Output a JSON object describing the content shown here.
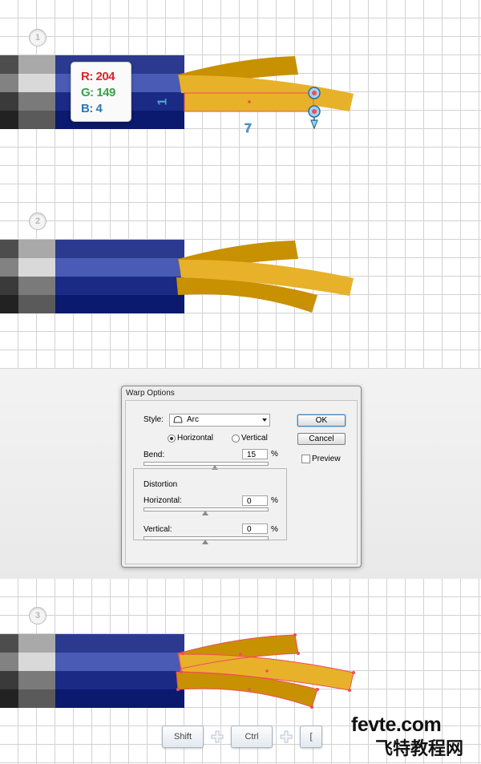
{
  "steps": [
    {
      "number": "1"
    },
    {
      "number": "2"
    },
    {
      "number": "3"
    }
  ],
  "swatch": {
    "r": "R: 204",
    "g": "G: 149",
    "b": "B: 4",
    "r_color": "#d9262b",
    "g_color": "#38a14a",
    "b_color": "#2d77b6"
  },
  "dimensions": {
    "height": "1",
    "width": "7"
  },
  "colors": {
    "tape": "#e8b12a",
    "tape_dark": "#c89102",
    "navy1": "#2b3a8f",
    "navy2": "#4a5bb6",
    "navy3": "#1b2a85",
    "navy4": "#0b1a6e",
    "selection": "#ef4d5a"
  },
  "dialog": {
    "title": "Warp Options",
    "style_label": "Style:",
    "style_value": "Arc",
    "horizontal_label": "Horizontal",
    "vertical_label": "Vertical",
    "orientation_selected": "Horizontal",
    "bend_label": "Bend:",
    "bend_value": "15",
    "percent": "%",
    "distortion_label": "Distortion",
    "dist_horizontal_label": "Horizontal:",
    "dist_horizontal_value": "0",
    "dist_vertical_label": "Vertical:",
    "dist_vertical_value": "0",
    "ok_label": "OK",
    "cancel_label": "Cancel",
    "preview_label": "Preview",
    "preview_checked": false,
    "bend_fraction": 0.575,
    "dist_h_fraction": 0.5,
    "dist_v_fraction": 0.5
  },
  "shortcut": {
    "keys": [
      "Shift",
      "Ctrl",
      "["
    ]
  },
  "watermark": {
    "site": "fevte.com",
    "name": "飞特教程网"
  }
}
